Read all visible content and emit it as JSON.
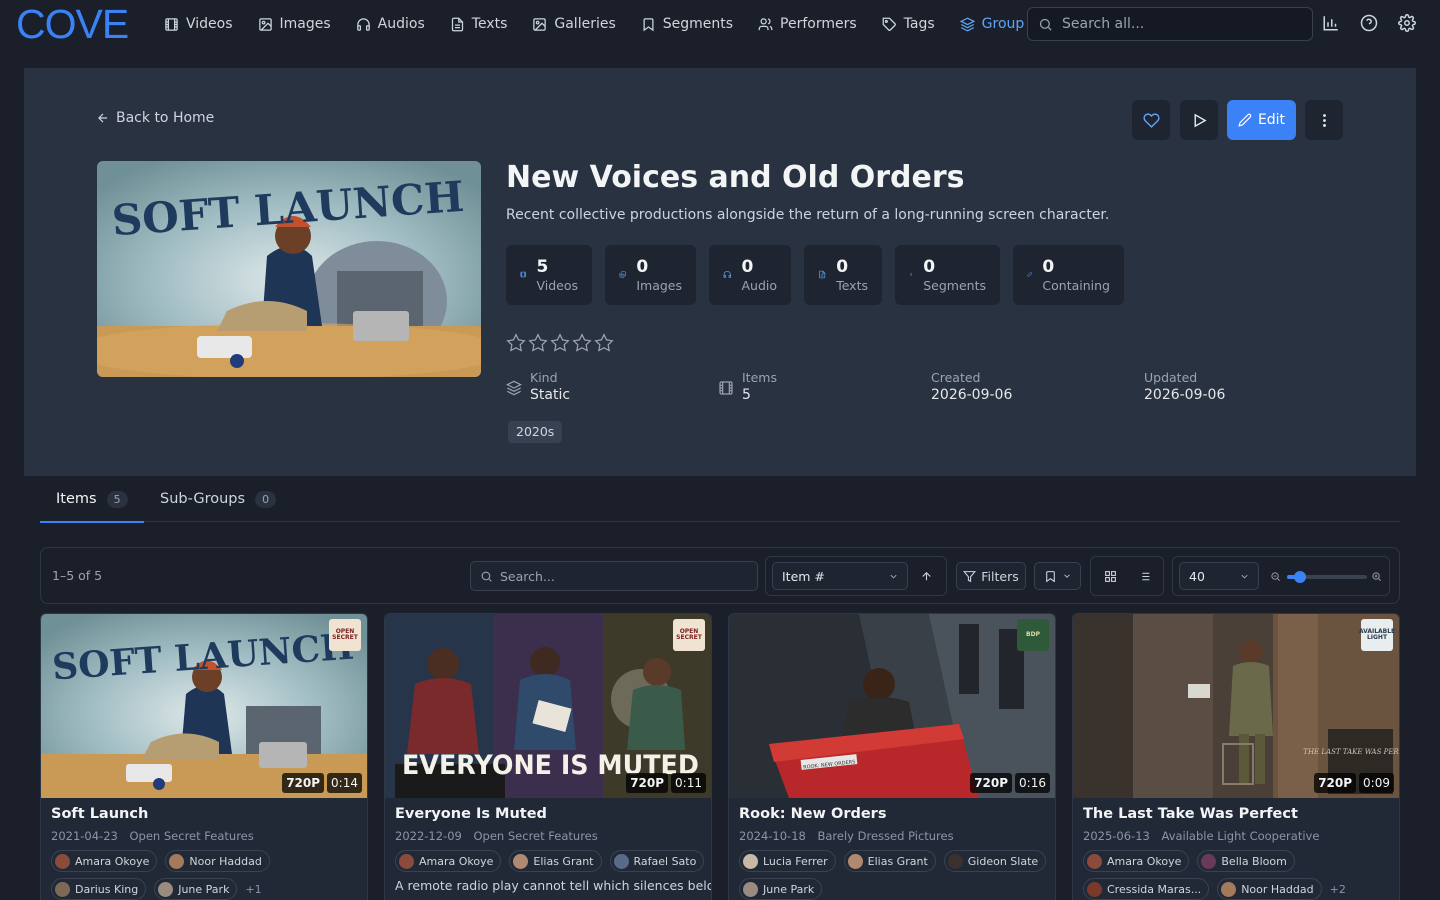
{
  "nav": {
    "logo": "COVE",
    "items": [
      {
        "label": "Videos",
        "icon": "film-icon"
      },
      {
        "label": "Images",
        "icon": "image-icon"
      },
      {
        "label": "Audios",
        "icon": "headphones-icon"
      },
      {
        "label": "Texts",
        "icon": "document-icon"
      },
      {
        "label": "Galleries",
        "icon": "gallery-icon"
      },
      {
        "label": "Segments",
        "icon": "bookmark-icon"
      },
      {
        "label": "Performers",
        "icon": "users-icon"
      },
      {
        "label": "Tags",
        "icon": "tag-icon"
      },
      {
        "label": "Group",
        "icon": "layers-icon",
        "active": true
      }
    ],
    "search_placeholder": "Search all...",
    "accent": "#3b82f6"
  },
  "hero": {
    "back_label": "Back to Home",
    "edit_label": "Edit",
    "title": "New Voices and Old Orders",
    "description": "Recent collective productions alongside the return of a long-running screen character.",
    "stats": [
      {
        "value": "5",
        "label": "Videos",
        "icon": "film-icon"
      },
      {
        "value": "0",
        "label": "Images",
        "icon": "images-icon"
      },
      {
        "value": "0",
        "label": "Audio",
        "icon": "headphones-icon"
      },
      {
        "value": "0",
        "label": "Texts",
        "icon": "document-icon"
      },
      {
        "value": "0",
        "label": "Segments",
        "icon": "merge-icon"
      },
      {
        "value": "0",
        "label": "Containing",
        "icon": "link-icon"
      }
    ],
    "rating": 0,
    "meta": {
      "kind_label": "Kind",
      "kind_value": "Static",
      "items_label": "Items",
      "items_value": "5",
      "created_label": "Created",
      "created_value": "2026-09-06",
      "updated_label": "Updated",
      "updated_value": "2026-09-06"
    },
    "tag": "2020s",
    "cover_text": "SOFT LAUNCH"
  },
  "tabs": [
    {
      "label": "Items",
      "count": "5",
      "active": true
    },
    {
      "label": "Sub-Groups",
      "count": "0"
    }
  ],
  "toolbar": {
    "range": "1–5 of 5",
    "search_placeholder": "Search...",
    "sort": "Item #",
    "filters_label": "Filters",
    "per_page": "40",
    "zoom_level": 0.1
  },
  "cards": [
    {
      "title": "Soft Launch",
      "date": "2021-04-23",
      "studio": "Open Secret Features",
      "resolution": "720P",
      "duration": "0:14",
      "thumb_text": "SOFT LAUNCH",
      "studio_logo": "OPEN SECRET",
      "performers": [
        "Amara Okoye",
        "Noor Haddad",
        "Darius King",
        "June Park"
      ],
      "more": "+1",
      "description": ""
    },
    {
      "title": "Everyone Is Muted",
      "date": "2022-12-09",
      "studio": "Open Secret Features",
      "resolution": "720P",
      "duration": "0:11",
      "thumb_text": "EVERYONE IS MUTED",
      "studio_logo": "OPEN SECRET",
      "performers": [
        "Amara Okoye",
        "Elias Grant",
        "Rafael Sato"
      ],
      "more": "",
      "description": "A remote radio play cannot tell which silences belong"
    },
    {
      "title": "Rook: New Orders",
      "date": "2024-10-18",
      "studio": "Barely Dressed Pictures",
      "resolution": "720P",
      "duration": "0:16",
      "thumb_text": "ROOK: NEW ORDERS",
      "studio_logo": "BDP",
      "performers": [
        "Lucia Ferrer",
        "Elias Grant",
        "Gideon Slate",
        "June Park"
      ],
      "more": "",
      "description": ""
    },
    {
      "title": "The Last Take Was Perfect",
      "date": "2025-06-13",
      "studio": "Available Light Cooperative",
      "resolution": "720P",
      "duration": "0:09",
      "thumb_text": "THE LAST TAKE WAS PERFECT",
      "studio_logo": "AVAILABLE LIGHT",
      "performers": [
        "Amara Okoye",
        "Bella Bloom",
        "Cressida Maras...",
        "Noor Haddad"
      ],
      "more": "+2",
      "description": ""
    }
  ]
}
